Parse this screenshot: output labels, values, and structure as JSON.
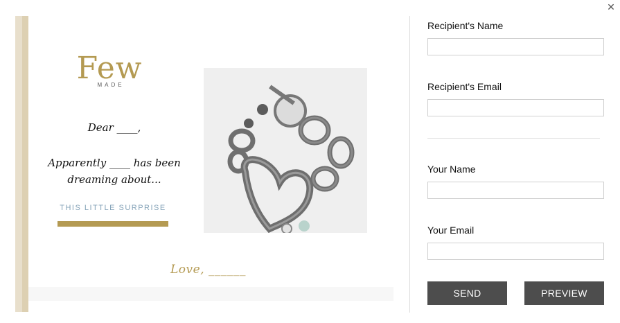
{
  "dialog": {
    "close_icon": "close-icon"
  },
  "card": {
    "logo": {
      "main": "Few",
      "sub": "MADE"
    },
    "greeting": "Dear ____,",
    "message_line1": "Apparently ____ has been",
    "message_line2": "dreaming about...",
    "surprise": "THIS LITTLE SURPRISE",
    "signoff": "Love, ______",
    "accent_color": "#b49a52",
    "product_image": "silver-heart-bracelet-photo"
  },
  "form": {
    "recipient_name": {
      "label": "Recipient's Name",
      "value": "",
      "placeholder": ""
    },
    "recipient_email": {
      "label": "Recipient's Email",
      "value": "",
      "placeholder": ""
    },
    "your_name": {
      "label": "Your Name",
      "value": "",
      "placeholder": ""
    },
    "your_email": {
      "label": "Your Email",
      "value": "",
      "placeholder": ""
    },
    "send_label": "SEND",
    "preview_label": "PREVIEW",
    "button_color": "#4d4d4d"
  }
}
